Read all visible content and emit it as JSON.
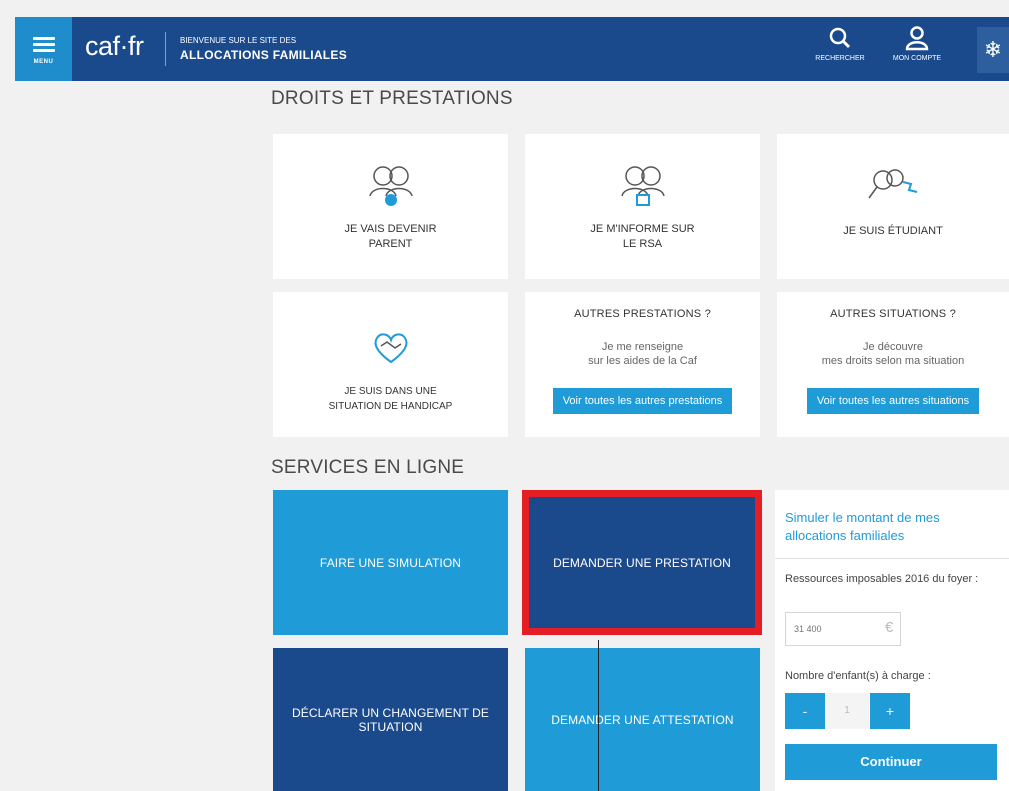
{
  "header": {
    "menu_label": "MENU",
    "logo": "caf·fr",
    "welcome_line1": "BIENVENUE SUR LE SITE DES",
    "welcome_line2": "ALLOCATIONS FAMILIALES",
    "search_label": "RECHERCHER",
    "account_label": "MON COMPTE"
  },
  "rights": {
    "title": "DROITS ET PRESTATIONS",
    "tiles": [
      {
        "label_l1": "JE VAIS DEVENIR",
        "label_l2": "PARENT",
        "icon": "parents-icon"
      },
      {
        "label_l1": "JE M'INFORME SUR",
        "label_l2": "LE RSA",
        "icon": "rsa-icon"
      },
      {
        "label_l1": "JE SUIS ÉTUDIANT",
        "label_l2": "",
        "icon": "student-keys-icon"
      },
      {
        "label_l1": "JE SUIS DANS UNE",
        "label_l2": "SITUATION DE HANDICAP",
        "icon": "handshake-heart-icon"
      }
    ],
    "other_benefits": {
      "heading": "AUTRES PRESTATIONS ?",
      "sub_l1": "Je me renseigne",
      "sub_l2": "sur les aides de la Caf",
      "button": "Voir toutes les autres prestations"
    },
    "other_situations": {
      "heading": "AUTRES SITUATIONS ?",
      "sub_l1": "Je découvre",
      "sub_l2": "mes droits selon ma situation",
      "button": "Voir toutes les autres situations"
    }
  },
  "services": {
    "title": "SERVICES EN LIGNE",
    "simulation": "FAIRE UNE SIMULATION",
    "request_benefit": "DEMANDER UNE PRESTATION",
    "declare_l1": "DÉCLARER UN CHANGEMENT DE",
    "declare_l2": "SITUATION",
    "request_certificate": "DEMANDER UNE ATTESTATION"
  },
  "simulator": {
    "title": "Simuler le montant de mes allocations familiales",
    "income_label": "Ressources imposables 2016 du foyer :",
    "income_placeholder": "31 400",
    "currency": "€",
    "children_label": "Nombre d'enfant(s) à charge :",
    "minus": "-",
    "plus": "+",
    "children_value": "1",
    "continue": "Continuer"
  },
  "colors": {
    "header": "#1b4a8c",
    "light_blue": "#1f9bd7",
    "highlight": "#e51d24"
  }
}
